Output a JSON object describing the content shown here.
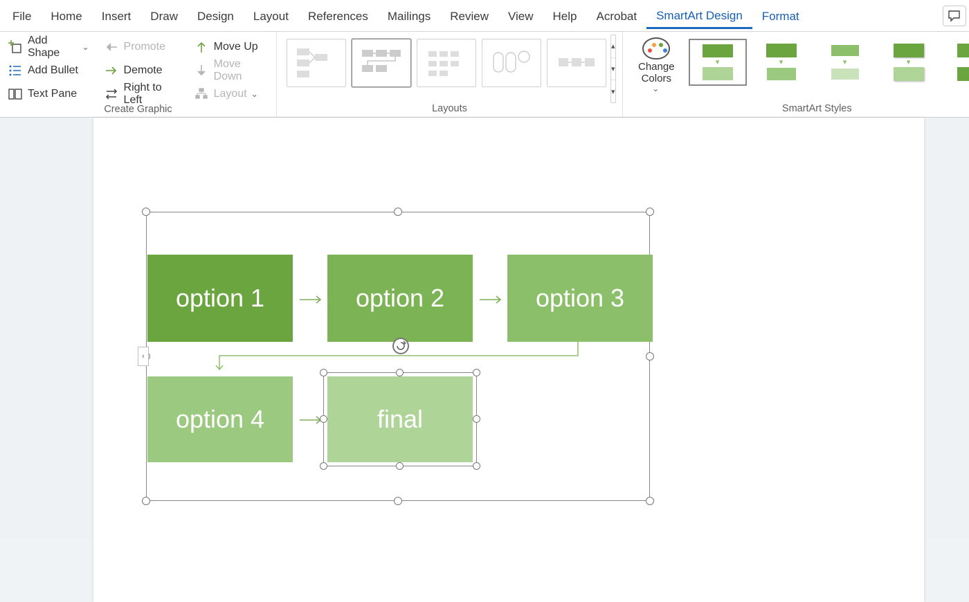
{
  "tabs": {
    "file": "File",
    "home": "Home",
    "insert": "Insert",
    "draw": "Draw",
    "design": "Design",
    "layout": "Layout",
    "references": "References",
    "mailings": "Mailings",
    "review": "Review",
    "view": "View",
    "help": "Help",
    "acrobat": "Acrobat",
    "smartart": "SmartArt Design",
    "format": "Format"
  },
  "ribbon": {
    "create_graphic": {
      "add_shape": "Add Shape",
      "add_bullet": "Add Bullet",
      "text_pane": "Text Pane",
      "promote": "Promote",
      "demote": "Demote",
      "rtl": "Right to Left",
      "move_up": "Move Up",
      "move_down": "Move Down",
      "layout": "Layout",
      "group_label": "Create Graphic"
    },
    "layouts_label": "Layouts",
    "change_colors": "Change\nColors",
    "styles_label": "SmartArt Styles"
  },
  "smartart": {
    "blocks": {
      "b1": "option 1",
      "b2": "option 2",
      "b3": "option 3",
      "b4": "option 4",
      "b5": "final"
    },
    "colors": {
      "c1": "#6ba53f",
      "c2": "#7cb354",
      "c3": "#8cbf6a",
      "c4": "#9cc980",
      "c5": "#aed498"
    }
  }
}
